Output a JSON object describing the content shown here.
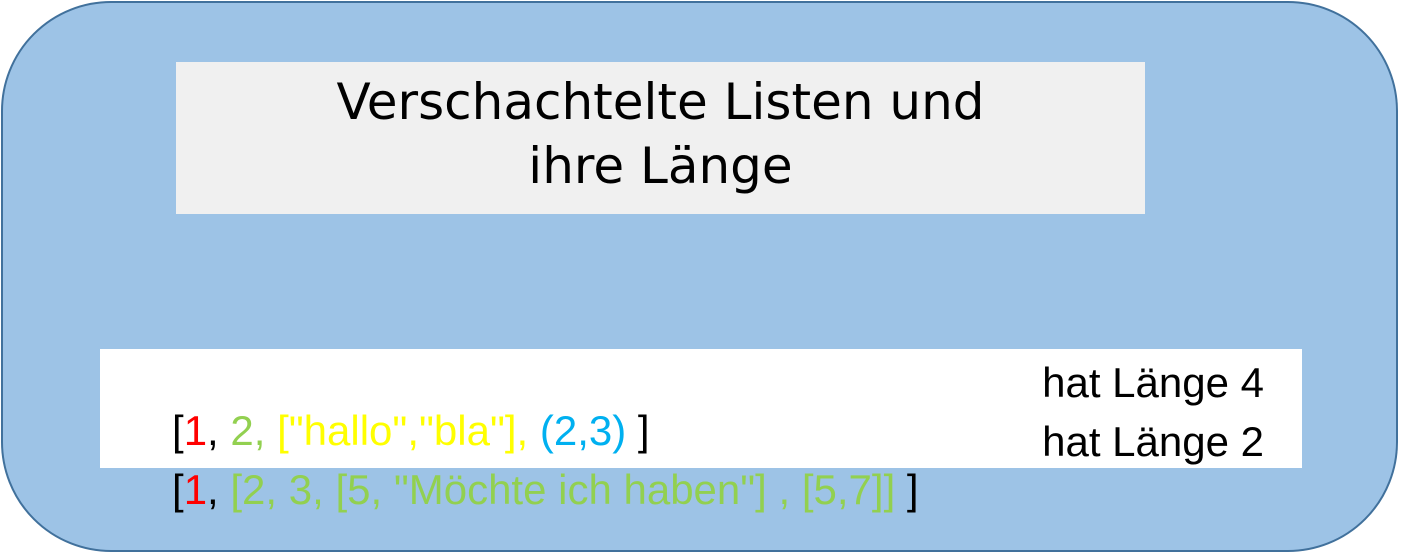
{
  "title": {
    "line1": "Verschachtelte Listen und",
    "line2": "ihre Länge"
  },
  "colors": {
    "panel_fill": "#9dc3e6",
    "panel_border": "#41719c",
    "title_bg": "#f0f0f0",
    "black": "#000000",
    "red": "#ff0000",
    "green": "#92d050",
    "yellow": "#ffff00",
    "blue": "#00b0f0"
  },
  "examples": [
    {
      "segments": [
        {
          "text": "[",
          "color": "#000000"
        },
        {
          "text": "1",
          "color": "#ff0000"
        },
        {
          "text": ", ",
          "color": "#000000"
        },
        {
          "text": "2, ",
          "color": "#92d050"
        },
        {
          "text": "[\"hallo\",\"bla\"], ",
          "color": "#ffff00"
        },
        {
          "text": "(2,3)",
          "color": "#00b0f0"
        },
        {
          "text": " ]",
          "color": "#000000"
        }
      ],
      "result": "hat Länge 4"
    },
    {
      "segments": [
        {
          "text": "[",
          "color": "#000000"
        },
        {
          "text": "1",
          "color": "#ff0000"
        },
        {
          "text": ", ",
          "color": "#000000"
        },
        {
          "text": "[2, 3, [5, \"Möchte ich haben\"] , [5,7]]",
          "color": "#92d050"
        },
        {
          "text": " ]",
          "color": "#000000"
        }
      ],
      "result": "hat Länge 2"
    }
  ]
}
